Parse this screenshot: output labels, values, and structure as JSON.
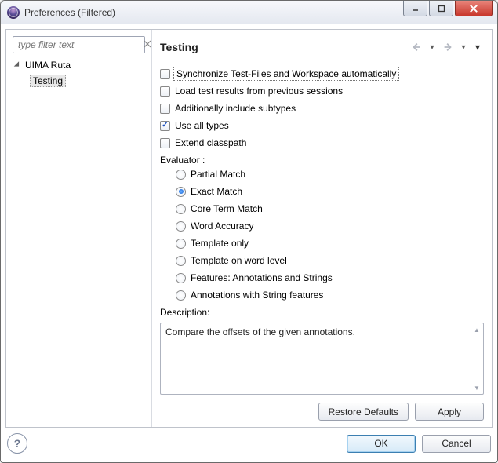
{
  "window": {
    "title": "Preferences (Filtered)"
  },
  "sidebar": {
    "filter_placeholder": "type filter text",
    "tree": {
      "parent": "UIMA Ruta",
      "child": "Testing"
    }
  },
  "page": {
    "title": "Testing",
    "checkboxes": [
      {
        "label": "Synchronize Test-Files and Workspace automatically",
        "checked": false,
        "focused": true
      },
      {
        "label": "Load test results from previous sessions",
        "checked": false,
        "focused": false
      },
      {
        "label": "Additionally include subtypes",
        "checked": false,
        "focused": false
      },
      {
        "label": "Use all types",
        "checked": true,
        "focused": false
      },
      {
        "label": "Extend classpath",
        "checked": false,
        "focused": false
      }
    ],
    "evaluator_label": "Evaluator :",
    "radios": [
      {
        "label": "Partial Match",
        "checked": false
      },
      {
        "label": "Exact Match",
        "checked": true
      },
      {
        "label": "Core Term Match",
        "checked": false
      },
      {
        "label": "Word Accuracy",
        "checked": false
      },
      {
        "label": "Template only",
        "checked": false
      },
      {
        "label": "Template on word level",
        "checked": false
      },
      {
        "label": "Features: Annotations and Strings",
        "checked": false
      },
      {
        "label": "Annotations with String features",
        "checked": false
      }
    ],
    "description_label": "Description:",
    "description_text": "Compare the offsets of the given annotations."
  },
  "buttons": {
    "restore_defaults": "Restore Defaults",
    "apply": "Apply",
    "ok": "OK",
    "cancel": "Cancel"
  }
}
